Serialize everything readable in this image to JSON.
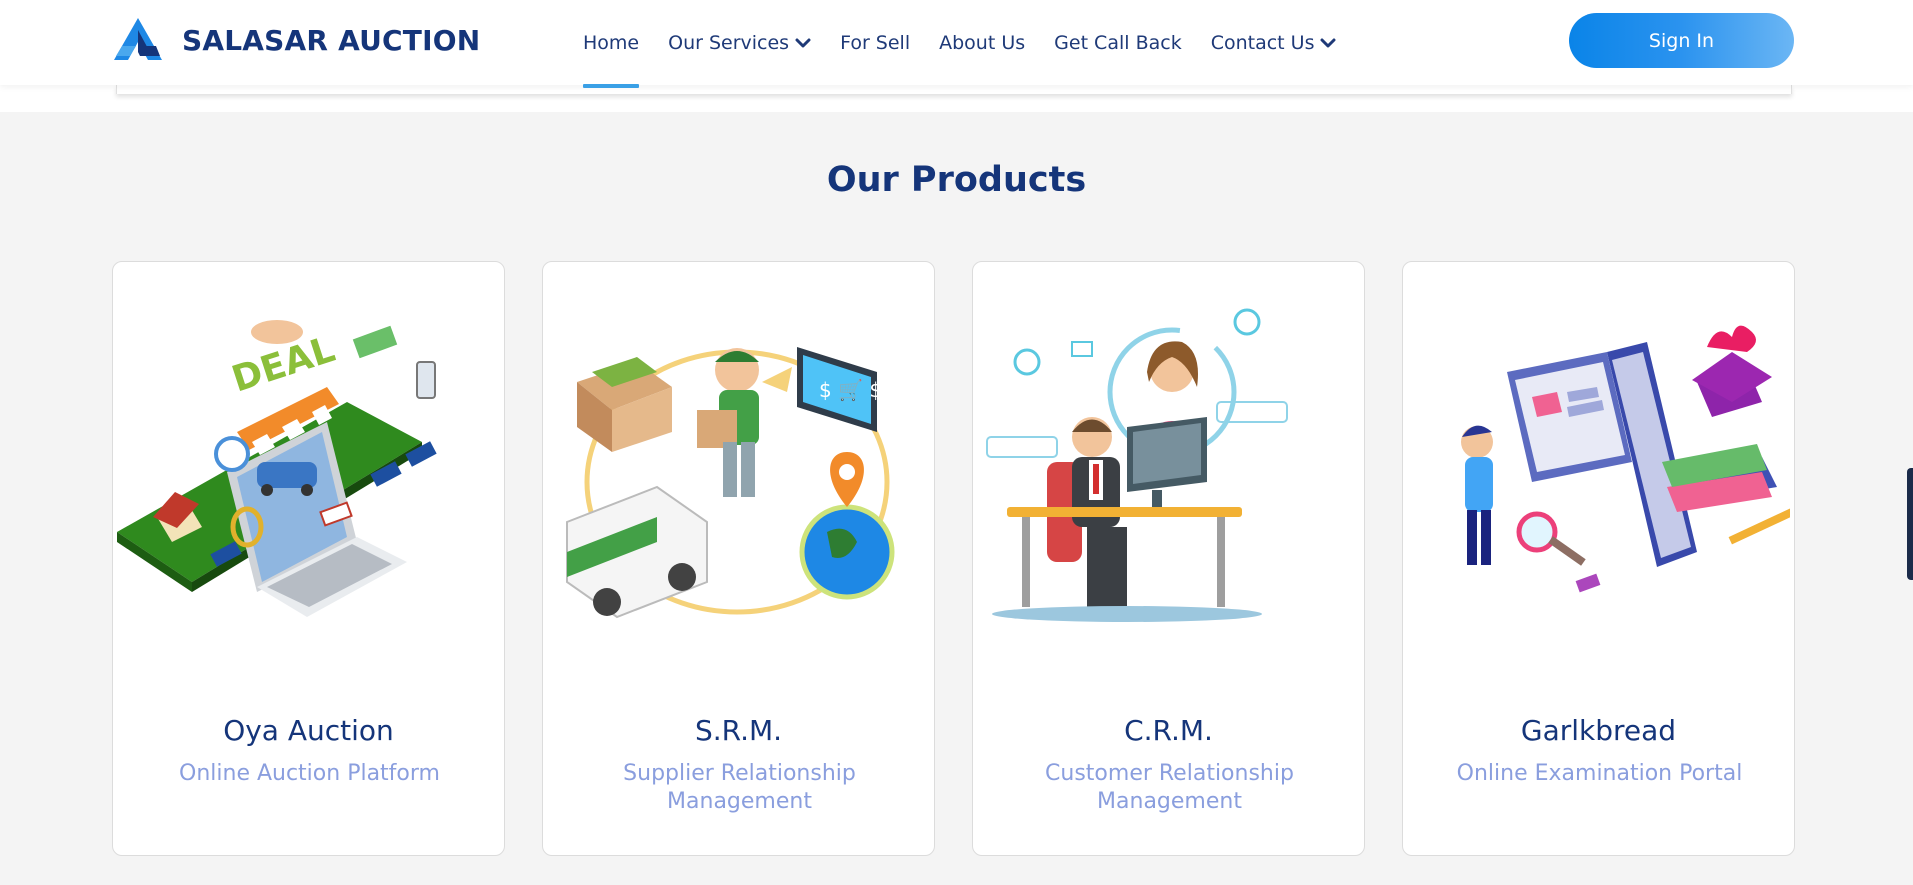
{
  "brand": {
    "name": "SALASAR AUCTION",
    "color": "#15357a",
    "accent": "#1e88e5"
  },
  "nav": {
    "items": [
      {
        "label": "Home",
        "active": true
      },
      {
        "label": "Our Services",
        "dropdown": true
      },
      {
        "label": "For Sell"
      },
      {
        "label": "About Us"
      },
      {
        "label": "Get Call Back"
      },
      {
        "label": "Contact Us",
        "dropdown": true
      }
    ],
    "signin_label": "Sign In"
  },
  "products": {
    "title": "Our Products",
    "items": [
      {
        "name": "Oya Auction",
        "subtitle": "Online Auction Platform",
        "icon": "online-auction-illustration"
      },
      {
        "name": "S.R.M.",
        "subtitle": "Supplier Relationship Management",
        "icon": "supplier-delivery-illustration"
      },
      {
        "name": "C.R.M.",
        "subtitle": "Customer Relationship Management",
        "icon": "customer-support-illustration"
      },
      {
        "name": "Garlkbread",
        "subtitle": "Online Examination Portal",
        "icon": "online-exam-illustration"
      }
    ]
  }
}
